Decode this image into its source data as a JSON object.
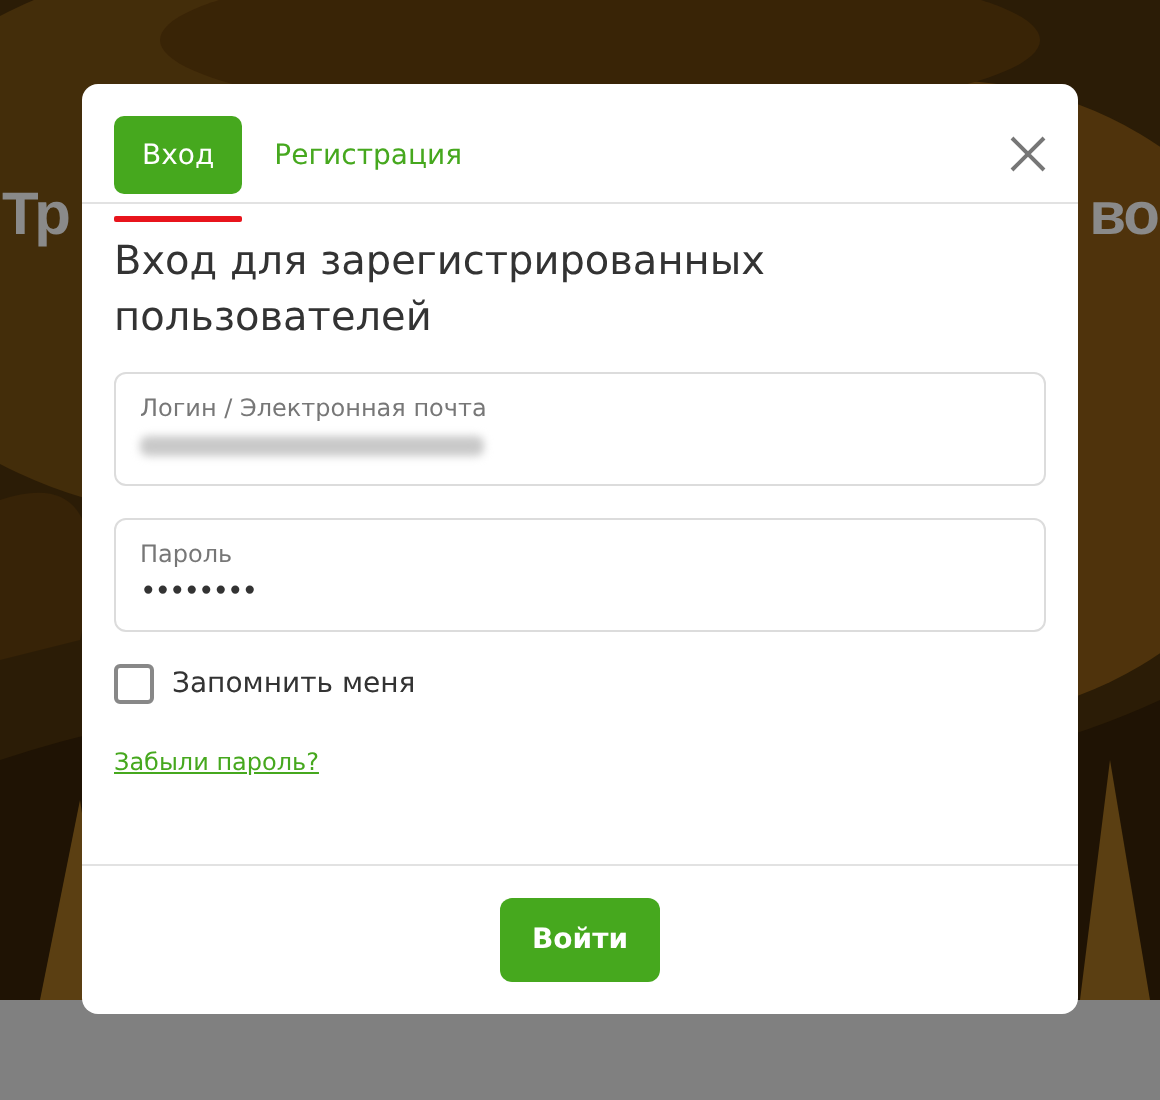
{
  "background": {
    "heading_left": "Тр",
    "heading_right": "во"
  },
  "tabs": [
    {
      "label": "Вход",
      "selected": true
    },
    {
      "label": "Регистрация",
      "selected": false
    }
  ],
  "title": "Вход для зарегистрированных пользователей",
  "fields": [
    {
      "label": "Логин / Электронная почта",
      "kind": "blurred"
    },
    {
      "label": "Пароль",
      "kind": "password",
      "value": "••••••••"
    }
  ],
  "remember": {
    "label": "Запомнить меня",
    "checked": false
  },
  "forgot_link": "Забыли пароль?",
  "submit": "Войти"
}
